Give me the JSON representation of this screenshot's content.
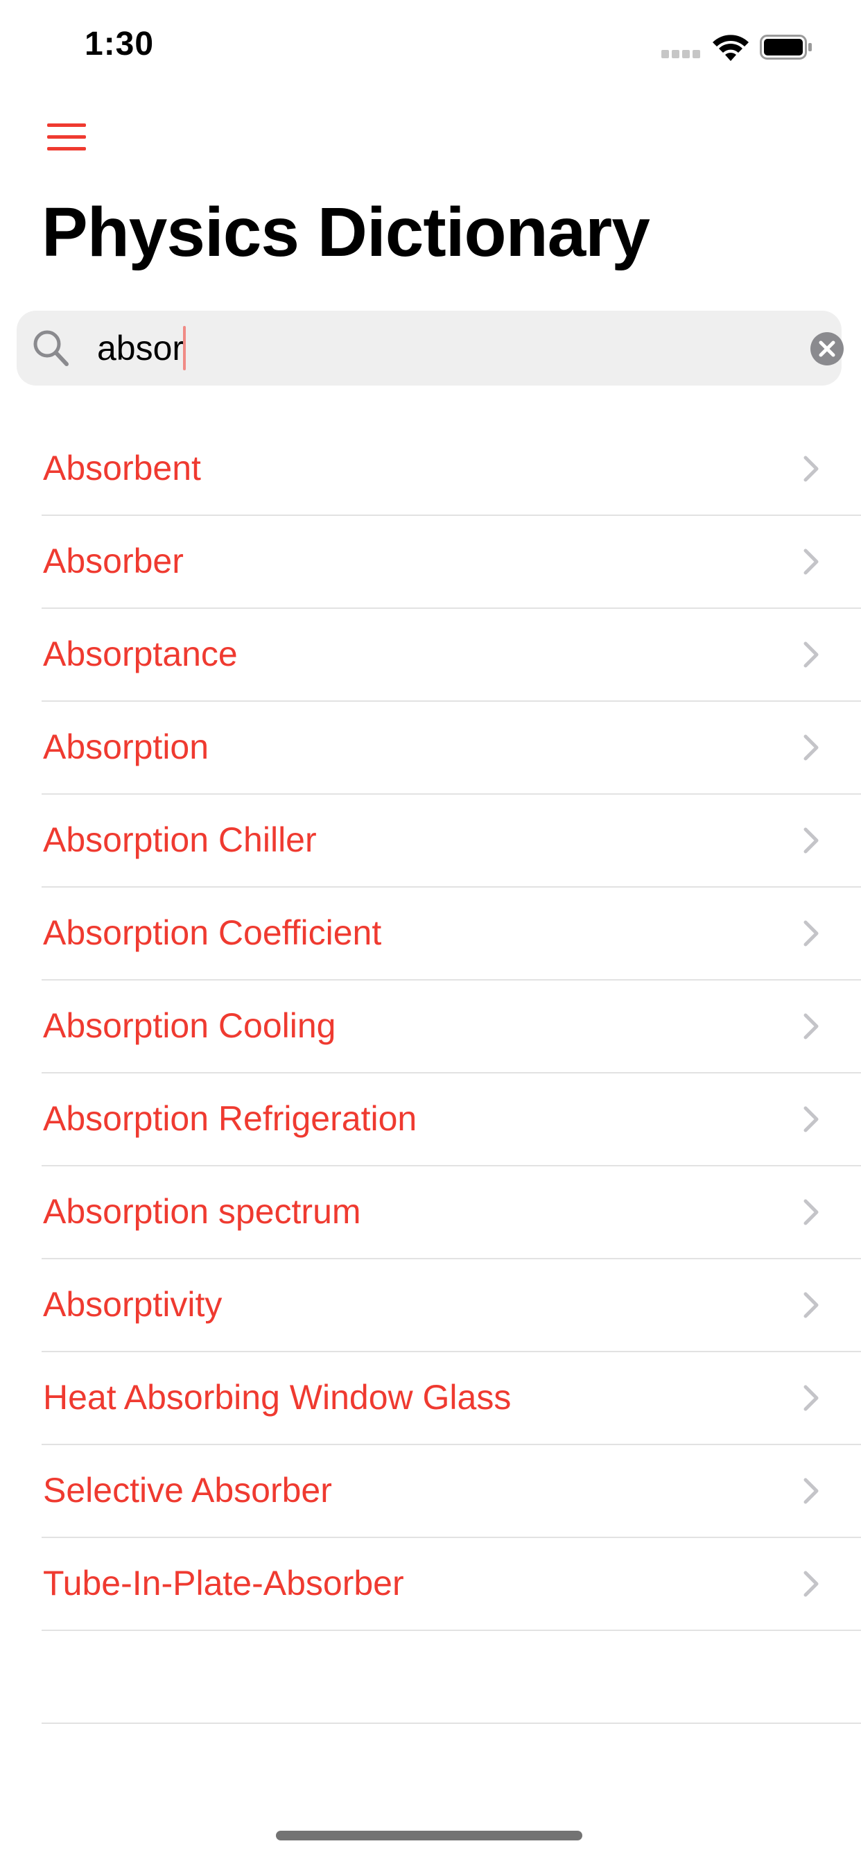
{
  "status_bar": {
    "time": "1:30"
  },
  "header": {
    "title": "Physics Dictionary",
    "menu_icon": "hamburger-menu-icon"
  },
  "search": {
    "value": "absor",
    "icon": "search-icon",
    "clear_icon": "clear-circle-icon"
  },
  "results": [
    {
      "label": "Absorbent"
    },
    {
      "label": "Absorber"
    },
    {
      "label": "Absorptance"
    },
    {
      "label": "Absorption"
    },
    {
      "label": "Absorption Chiller"
    },
    {
      "label": "Absorption Coefficient"
    },
    {
      "label": "Absorption Cooling"
    },
    {
      "label": "Absorption Refrigeration"
    },
    {
      "label": "Absorption spectrum"
    },
    {
      "label": "Absorptivity"
    },
    {
      "label": "Heat Absorbing Window Glass"
    },
    {
      "label": "Selective Absorber"
    },
    {
      "label": "Tube-In-Plate-Absorber"
    }
  ],
  "colors": {
    "accent": "#ef3a30",
    "search_background": "#efefef",
    "separator": "#e2e2e2",
    "chevron": "#c4c4c8"
  }
}
